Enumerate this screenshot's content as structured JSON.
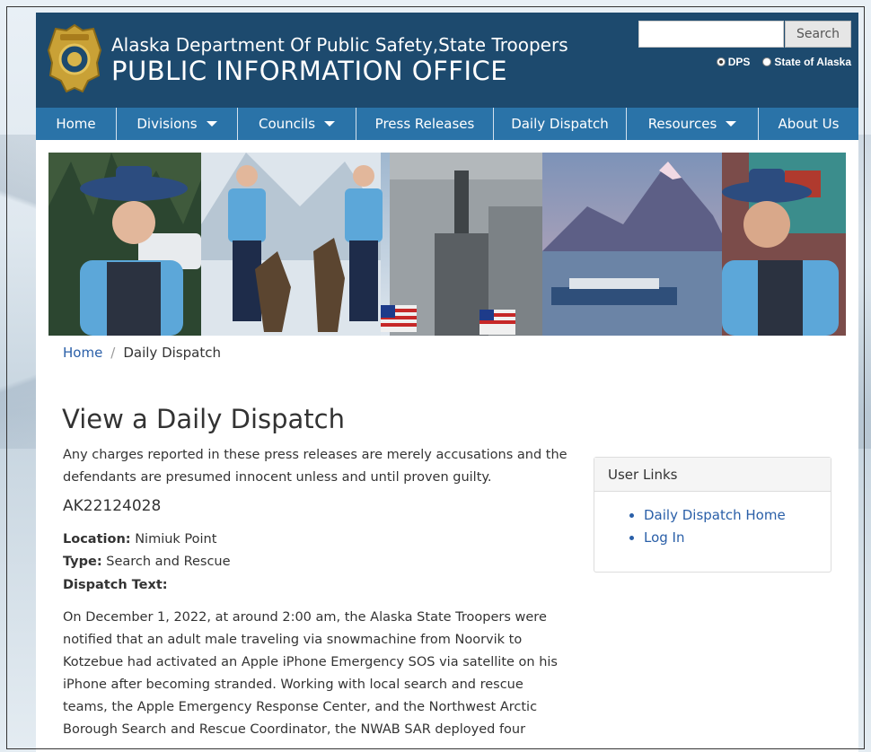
{
  "header": {
    "title_line1": "Alaska Department Of Public Safety,State Troopers",
    "title_line2": "PUBLIC INFORMATION OFFICE",
    "search_placeholder": "",
    "search_button": "Search",
    "radio_options": [
      {
        "label": "DPS",
        "checked": true
      },
      {
        "label": "State of Alaska",
        "checked": false
      }
    ],
    "colors": {
      "header_bg": "#1d4a6e",
      "nav_bg": "#2a73a8",
      "link": "#2a5fa8"
    }
  },
  "nav": {
    "items": [
      {
        "label": "Home",
        "has_dropdown": false
      },
      {
        "label": "Divisions",
        "has_dropdown": true
      },
      {
        "label": "Councils",
        "has_dropdown": true
      },
      {
        "label": "Press Releases",
        "has_dropdown": false
      },
      {
        "label": "Daily Dispatch",
        "has_dropdown": false
      },
      {
        "label": "Resources",
        "has_dropdown": true
      },
      {
        "label": "About Us",
        "has_dropdown": false
      }
    ]
  },
  "breadcrumb": {
    "home": "Home",
    "separator": "/",
    "current": "Daily Dispatch"
  },
  "main": {
    "heading": "View a Daily Dispatch",
    "disclaimer": "Any charges reported in these press releases are merely accusations and the defendants are presumed innocent unless and until proven guilty.",
    "case_id": "AK22124028",
    "location_label": "Location:",
    "location_value": "Nimiuk Point",
    "type_label": "Type:",
    "type_value": "Search and Rescue",
    "dispatch_label": "Dispatch Text:",
    "dispatch_text": "On December 1, 2022, at around 2:00 am, the Alaska State Troopers were notified that an adult male traveling via snowmachine from Noorvik to Kotzebue had activated an Apple iPhone Emergency SOS via satellite on his iPhone after becoming stranded. Working with local search and rescue teams, the Apple Emergency Response Center, and the Northwest Arctic Borough Search and Rescue Coordinator, the NWAB SAR deployed four"
  },
  "sidebar": {
    "panel_title": "User Links",
    "links": [
      "Daily Dispatch Home",
      "Log In"
    ]
  }
}
